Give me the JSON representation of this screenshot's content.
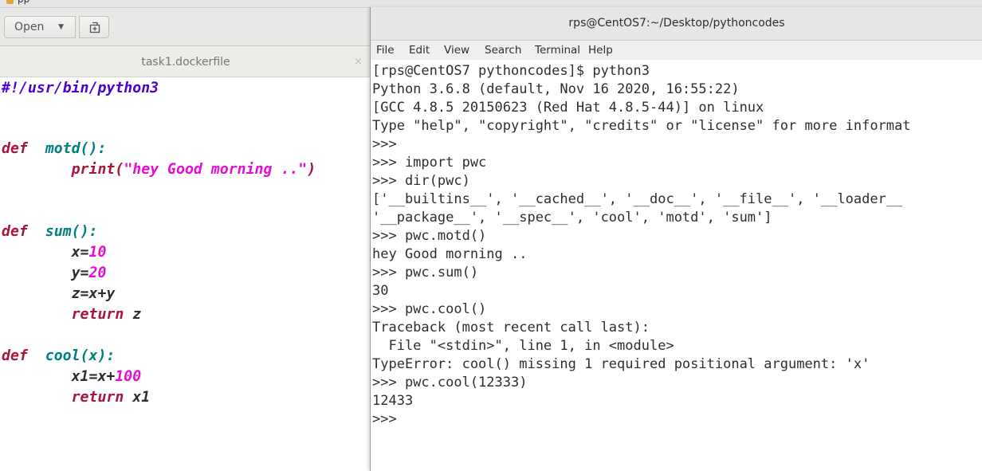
{
  "topbar": {
    "app_label": "pp"
  },
  "gedit": {
    "open_label": "Open",
    "tab_title": "task1.dockerfile",
    "tab_close": "×",
    "code": {
      "shebang": "#!/usr/bin/python3",
      "def": "def",
      "return": "return",
      "motd_sig": "motd():",
      "print_call": "print(",
      "print_str": "\"hey Good morning ..\"",
      "print_end": ")",
      "sum_sig": "sum():",
      "x_assign": "x=",
      "x_val": "10",
      "y_assign": "y=",
      "y_val": "20",
      "z_assign": "z=x+y",
      "return_z": " z",
      "cool_sig": "cool(x):",
      "x1_assign": "x1=x+",
      "x1_val": "100",
      "return_x1": " x1"
    }
  },
  "terminal": {
    "title": "rps@CentOS7:~/Desktop/pythoncodes",
    "menu": [
      "File",
      "Edit",
      "View",
      "Search",
      "Terminal",
      "Help"
    ],
    "lines": [
      "[rps@CentOS7 pythoncodes]$ python3",
      "Python 3.6.8 (default, Nov 16 2020, 16:55:22)",
      "[GCC 4.8.5 20150623 (Red Hat 4.8.5-44)] on linux",
      "Type \"help\", \"copyright\", \"credits\" or \"license\" for more informat",
      ">>>",
      ">>> import pwc",
      ">>> dir(pwc)",
      "['__builtins__', '__cached__', '__doc__', '__file__', '__loader__",
      "'__package__', '__spec__', 'cool', 'motd', 'sum']",
      ">>> pwc.motd()",
      "hey Good morning ..",
      ">>> pwc.sum()",
      "30",
      ">>> pwc.cool()",
      "Traceback (most recent call last):",
      "  File \"<stdin>\", line 1, in <module>",
      "TypeError: cool() missing 1 required positional argument: 'x'",
      ">>> pwc.cool(12333)",
      "12433",
      ">>>"
    ]
  }
}
